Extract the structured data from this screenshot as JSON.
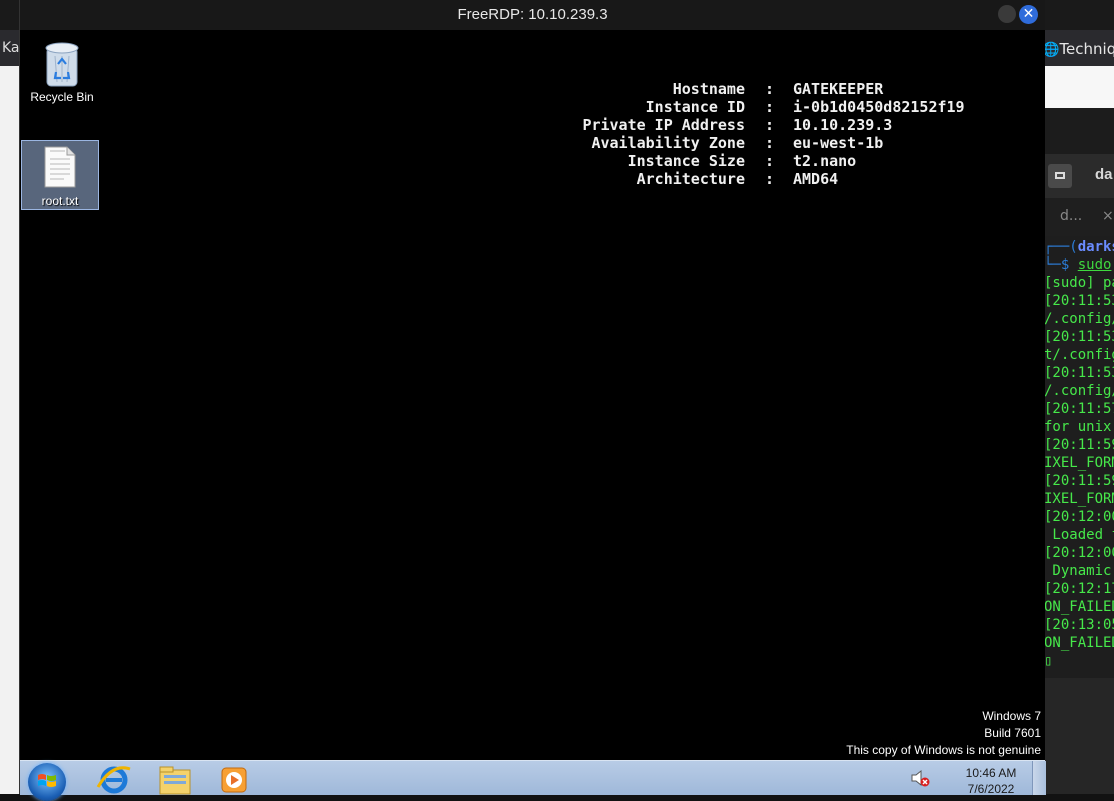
{
  "host": {
    "browser_tab_left": "Ka",
    "browser_tab_right": "Techniq",
    "terminal": {
      "title": "da",
      "tab_label": "d...",
      "tab_close": "×",
      "lines": [
        {
          "type": "prompt1",
          "text": "┌──(",
          "user": "darks"
        },
        {
          "type": "prompt2",
          "text": "└─$ ",
          "cmd": "sudo"
        },
        {
          "type": "out",
          "text": "[sudo] pa"
        },
        {
          "type": "out",
          "text": "[20:11:53"
        },
        {
          "type": "out",
          "text": "/.config/"
        },
        {
          "type": "out",
          "text": "[20:11:53"
        },
        {
          "type": "out",
          "text": "t/.config"
        },
        {
          "type": "out",
          "text": "[20:11:53"
        },
        {
          "type": "out",
          "text": "/.config/"
        },
        {
          "type": "out",
          "text": "[20:11:57"
        },
        {
          "type": "out",
          "text": "for unix"
        },
        {
          "type": "out",
          "text": "[20:11:59"
        },
        {
          "type": "out",
          "text": "IXEL_FORM"
        },
        {
          "type": "out",
          "text": "[20:11:59"
        },
        {
          "type": "out",
          "text": "IXEL_FORM"
        },
        {
          "type": "out",
          "text": "[20:12:00"
        },
        {
          "type": "out",
          "text": " Loaded f"
        },
        {
          "type": "out",
          "text": "[20:12:00"
        },
        {
          "type": "out",
          "text": " Dynamic"
        },
        {
          "type": "out",
          "text": "[20:12:17"
        },
        {
          "type": "out",
          "text": "ON_FAILED"
        },
        {
          "type": "out",
          "text": "[20:13:05"
        },
        {
          "type": "out",
          "text": "ON_FAILED"
        },
        {
          "type": "out",
          "text": "▯"
        }
      ]
    }
  },
  "rdp": {
    "title": "FreeRDP: 10.10.239.3",
    "close_glyph": "✕",
    "desktop": {
      "icons": [
        {
          "label": "Recycle Bin"
        },
        {
          "label": "root.txt"
        }
      ],
      "bginfo": [
        {
          "key": "Hostname",
          "sep": ":",
          "value": "GATEKEEPER"
        },
        {
          "key": "Instance ID",
          "sep": ":",
          "value": "i-0b1d0450d82152f19"
        },
        {
          "key": "Private IP Address",
          "sep": ":",
          "value": "10.10.239.3"
        },
        {
          "key": "Availability Zone",
          "sep": ":",
          "value": "eu-west-1b"
        },
        {
          "key": "Instance Size",
          "sep": ":",
          "value": "t2.nano"
        },
        {
          "key": "Architecture",
          "sep": ":",
          "value": "AMD64"
        }
      ],
      "genuine": {
        "line1": "Windows 7",
        "line2": "Build 7601",
        "line3": "This copy of Windows is not genuine"
      }
    },
    "taskbar": {
      "clock_time": "10:46 AM",
      "clock_date": "7/6/2022",
      "apps": [
        "internet-explorer-icon",
        "windows-explorer-icon",
        "media-player-icon"
      ]
    }
  }
}
